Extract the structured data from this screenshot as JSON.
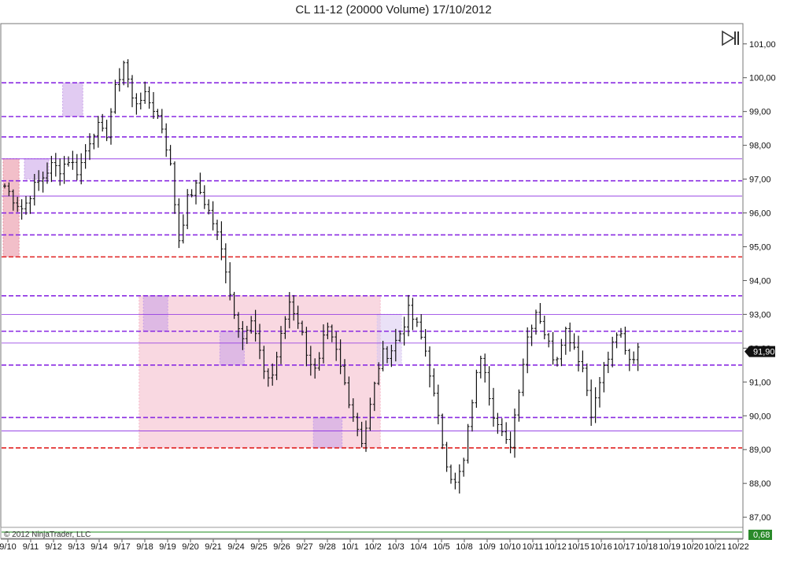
{
  "chart_data": {
    "type": "ohlc",
    "title": "CL 11-12 (20000 Volume)  17/10/2012",
    "copyright": "© 2012 NinjaTrader, LLC",
    "ylim": [
      86.7,
      101.6
    ],
    "y_ticks": [
      "87,00",
      "88,00",
      "89,00",
      "90,00",
      "91,00",
      "92,00",
      "93,00",
      "94,00",
      "95,00",
      "96,00",
      "97,00",
      "98,00",
      "99,00",
      "100,00",
      "101,00"
    ],
    "current_price_label": "91,90",
    "current_price": 91.9,
    "volume_panel_label": "0,68",
    "x_labels": [
      "9/10",
      "9/11",
      "9/12",
      "9/13",
      "9/14",
      "9/17",
      "9/18",
      "9/19",
      "9/20",
      "9/21",
      "9/24",
      "9/25",
      "9/26",
      "9/27",
      "9/28",
      "10/1",
      "10/2",
      "10/3",
      "10/4",
      "10/5",
      "10/8",
      "10/9",
      "10/10",
      "10/11",
      "10/12",
      "10/15",
      "10/16",
      "10/17",
      "10/18",
      "10/19",
      "10/20",
      "10/21",
      "10/22"
    ],
    "close_path": [
      96.8,
      96.4,
      96.1,
      96.7,
      97.0,
      97.4,
      97.3,
      97.6,
      97.2,
      98.0,
      98.6,
      98.2,
      99.6,
      100.5,
      99.2,
      99.5,
      99.2,
      98.7,
      97.5,
      95.2,
      96.5,
      96.8,
      96.2,
      95.5,
      94.5,
      93.0,
      92.4,
      92.8,
      91.5,
      91.0,
      92.2,
      93.4,
      92.8,
      91.8,
      91.2,
      92.6,
      92.0,
      91.0,
      90.0,
      89.2,
      90.5,
      91.8,
      91.9,
      92.4,
      93.1,
      92.6,
      91.8,
      90.2,
      88.8,
      87.9,
      88.6,
      90.6,
      92.0,
      90.3,
      89.5,
      89.0,
      90.8,
      92.4,
      93.2,
      92.3,
      91.6,
      92.6,
      92.1,
      91.4,
      90.0,
      91.2,
      91.9,
      92.5,
      91.7,
      91.9
    ],
    "horizontal_levels": [
      {
        "price": 99.85,
        "color": "#8a2be2",
        "style": "dashed",
        "weight": "heavy"
      },
      {
        "price": 98.85,
        "color": "#8a2be2",
        "style": "dashed",
        "weight": "heavy"
      },
      {
        "price": 98.25,
        "color": "#8a2be2",
        "style": "dashed",
        "weight": "heavy"
      },
      {
        "price": 97.6,
        "color": "#8a2be2",
        "style": "solid",
        "weight": "thin"
      },
      {
        "price": 96.95,
        "color": "#8a2be2",
        "style": "dashed",
        "weight": "heavy"
      },
      {
        "price": 96.5,
        "color": "#8a2be2",
        "style": "solid",
        "weight": "thin"
      },
      {
        "price": 96.0,
        "color": "#8a2be2",
        "style": "dashed",
        "weight": "heavy"
      },
      {
        "price": 95.35,
        "color": "#8a2be2",
        "style": "dashed",
        "weight": "heavy"
      },
      {
        "price": 94.7,
        "color": "#e02020",
        "style": "dashed",
        "weight": "heavy"
      },
      {
        "price": 93.55,
        "color": "#8a2be2",
        "style": "dashed",
        "weight": "heavy"
      },
      {
        "price": 93.0,
        "color": "#8a2be2",
        "style": "solid",
        "weight": "thin"
      },
      {
        "price": 92.5,
        "color": "#8a2be2",
        "style": "dashed",
        "weight": "heavy"
      },
      {
        "price": 92.15,
        "color": "#8a2be2",
        "style": "solid",
        "weight": "thin"
      },
      {
        "price": 91.5,
        "color": "#8a2be2",
        "style": "dashed",
        "weight": "heavy"
      },
      {
        "price": 89.95,
        "color": "#8a2be2",
        "style": "dashed",
        "weight": "heavy"
      },
      {
        "price": 89.55,
        "color": "#8a2be2",
        "style": "solid",
        "weight": "thin"
      },
      {
        "price": 89.05,
        "color": "#e02020",
        "style": "dashed",
        "weight": "heavy"
      }
    ],
    "zones": [
      {
        "bar_from": 0,
        "bar_to": 3,
        "price_low": 94.7,
        "price_high": 97.6,
        "color": "#e78a9c"
      },
      {
        "bar_from": 5,
        "bar_to": 10,
        "price_low": 97.0,
        "price_high": 97.6,
        "color": "#c8a0e8"
      },
      {
        "bar_from": 14,
        "bar_to": 18,
        "price_low": 98.85,
        "price_high": 99.85,
        "color": "#c8a0e8"
      },
      {
        "bar_from": 32,
        "bar_to": 88,
        "price_low": 89.05,
        "price_high": 93.55,
        "color": "#f4b8c8"
      },
      {
        "bar_from": 33,
        "bar_to": 38,
        "price_low": 92.5,
        "price_high": 93.55,
        "color": "#c8a0e8"
      },
      {
        "bar_from": 51,
        "bar_to": 56,
        "price_low": 91.5,
        "price_high": 92.5,
        "color": "#c8a0e8"
      },
      {
        "bar_from": 73,
        "bar_to": 79,
        "price_low": 89.05,
        "price_high": 89.95,
        "color": "#c8a0e8"
      },
      {
        "bar_from": 88,
        "bar_to": 93,
        "price_low": 91.5,
        "price_high": 93.0,
        "color": "#d8c8f0"
      }
    ],
    "grid": false,
    "legend": "none"
  }
}
